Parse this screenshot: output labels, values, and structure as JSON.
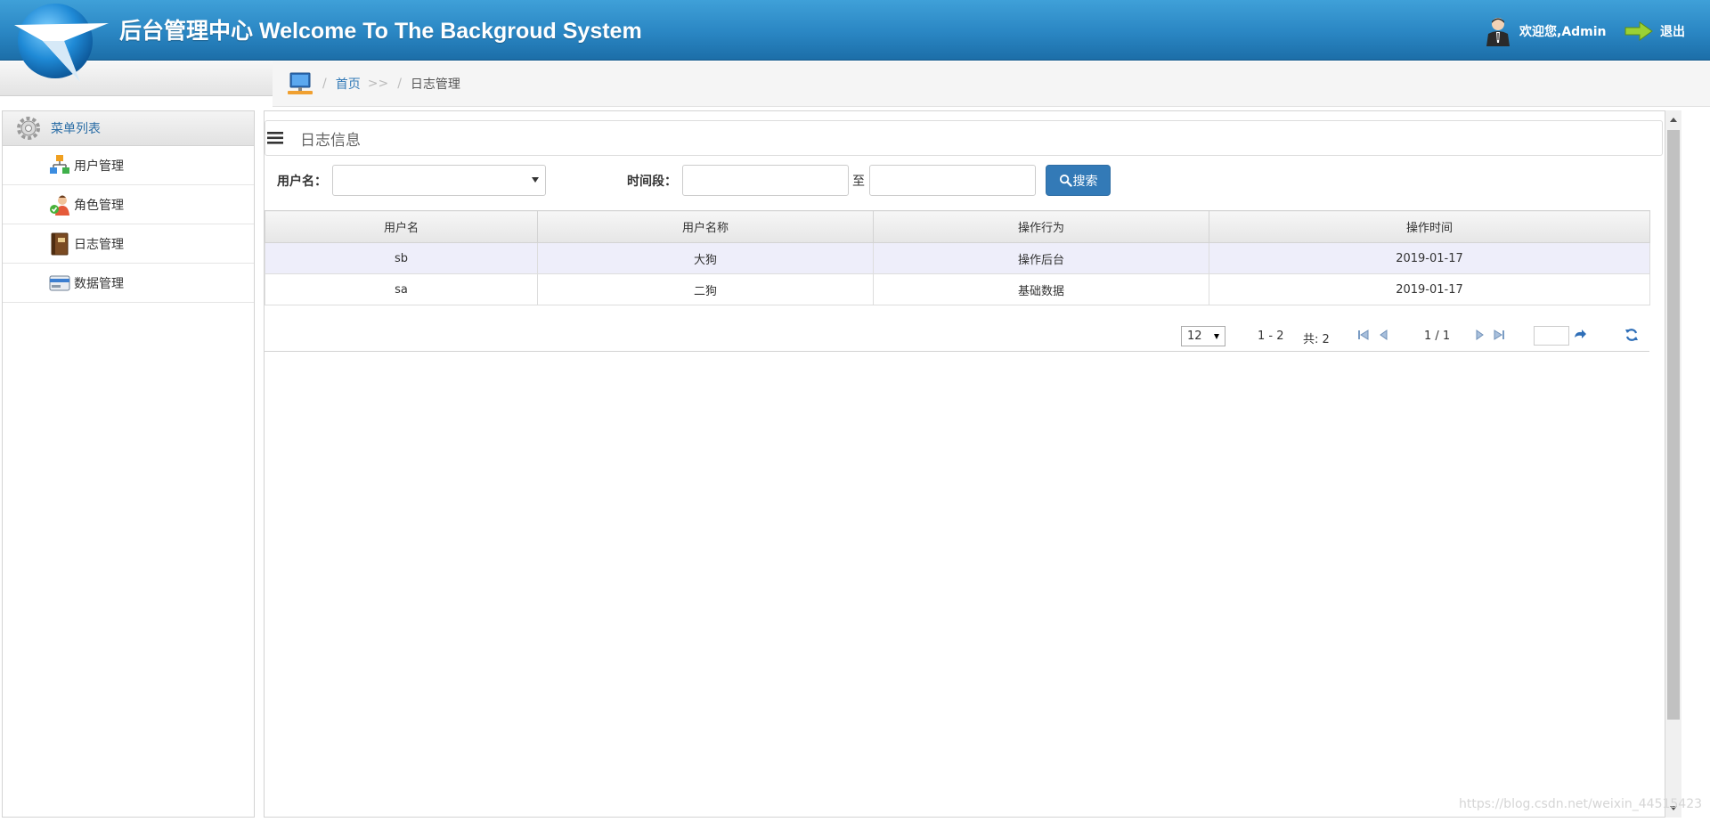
{
  "header": {
    "title": "后台管理中心 Welcome To The Backgroud System",
    "welcome": "欢迎您,Admin",
    "logout": "退出"
  },
  "breadcrumb": {
    "sep1": "/",
    "home": "首页",
    "arrows": ">>",
    "sep2": "/",
    "current": "日志管理"
  },
  "sidebar": {
    "heading": "菜单列表",
    "items": [
      {
        "label": "用户管理",
        "icon": "user-tree-icon"
      },
      {
        "label": "角色管理",
        "icon": "role-person-icon"
      },
      {
        "label": "日志管理",
        "icon": "log-book-icon"
      },
      {
        "label": "数据管理",
        "icon": "data-card-icon"
      }
    ]
  },
  "panel": {
    "title": "日志信息"
  },
  "search": {
    "username_label": "用户名：",
    "username_value": "",
    "period_label": "时间段：",
    "start_value": "",
    "to_label": "至",
    "end_value": "",
    "button_label": "搜索"
  },
  "table": {
    "columns": [
      "用户名",
      "用户名称",
      "操作行为",
      "操作时间"
    ],
    "rows": [
      [
        "sb",
        "大狗",
        "操作后台",
        "2019-01-17"
      ],
      [
        "sa",
        "二狗",
        "基础数据",
        "2019-01-17"
      ]
    ]
  },
  "pager": {
    "page_size": "12",
    "range": "1 - 2",
    "total": "共: 2",
    "page_of": "1 / 1",
    "goto_value": ""
  },
  "watermark": "https://blog.csdn.net/weixin_44515423",
  "colors": {
    "header_blue": "#2a86c3",
    "link_blue": "#337ab7",
    "button_blue": "#337ab7",
    "sidebar_heading": "#2c6ea6",
    "row_highlight": "#eeeefa"
  }
}
